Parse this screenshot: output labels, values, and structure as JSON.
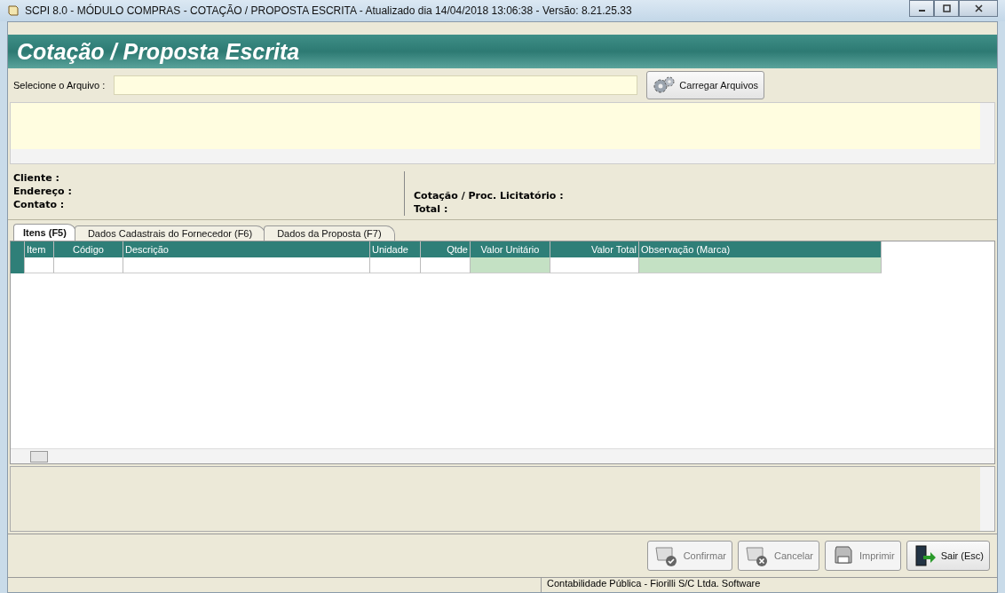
{
  "window": {
    "title": "SCPI 8.0 - MÓDULO COMPRAS - COTAÇÃO / PROPOSTA ESCRITA - Atualizado dia 14/04/2018 13:06:38 - Versão: 8.21.25.33"
  },
  "header": {
    "title": "Cotação / Proposta Escrita"
  },
  "file": {
    "label": "Selecione o Arquivo :",
    "button": "Carregar Arquivos"
  },
  "info": {
    "left": [
      "Cliente :",
      "Endereço :",
      "Contato :"
    ],
    "right": [
      "Cotação / Proc. Licitatório :",
      "Total :"
    ]
  },
  "tabs": [
    {
      "label": "Itens (F5)",
      "selected": true
    },
    {
      "label": "Dados Cadastrais do Fornecedor (F6)",
      "selected": false
    },
    {
      "label": "Dados da Proposta (F7)",
      "selected": false
    }
  ],
  "table": {
    "columns": [
      {
        "label": "Item",
        "editable": false
      },
      {
        "label": "Código",
        "editable": false
      },
      {
        "label": "Descrição",
        "editable": false
      },
      {
        "label": "Unidade",
        "editable": false
      },
      {
        "label": "Qtde",
        "editable": false
      },
      {
        "label": "Valor Unitário",
        "editable": true
      },
      {
        "label": "Valor Total",
        "editable": false
      },
      {
        "label": "Observação (Marca)",
        "editable": true
      }
    ]
  },
  "buttons": [
    {
      "label": "Confirmar",
      "kind": "confirm",
      "disabled": true
    },
    {
      "label": "Cancelar",
      "kind": "cancel",
      "disabled": true
    },
    {
      "label": "Imprimir",
      "kind": "print",
      "disabled": true
    },
    {
      "label": "Sair (Esc)",
      "kind": "exit",
      "disabled": false
    }
  ],
  "status_bar": {
    "text": "Contabilidade Pública - Fiorilli S/C Ltda. Software"
  }
}
